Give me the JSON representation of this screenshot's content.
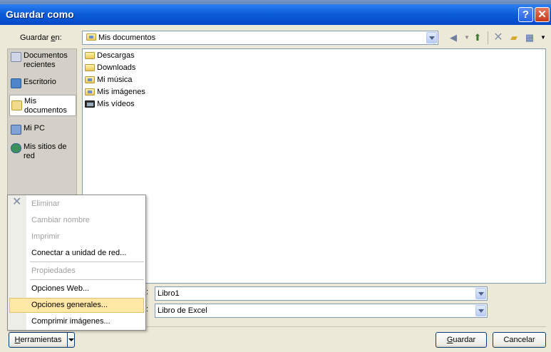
{
  "window": {
    "title": "Guardar como",
    "help_label": "?",
    "close_label": "✕"
  },
  "save_in": {
    "label_pre": "Guardar ",
    "label_key": "e",
    "label_post": "n:",
    "value": "Mis documentos"
  },
  "toolbar": {
    "back_icon": "back-arrow-icon",
    "up_icon": "up-folder-icon",
    "delete_icon": "delete-icon",
    "new_folder_icon": "new-folder-icon",
    "views_icon": "views-icon"
  },
  "places": [
    {
      "label": "Documentos recientes",
      "icon": "recent-documents-icon"
    },
    {
      "label": "Escritorio",
      "icon": "desktop-icon"
    },
    {
      "label": "Mis documentos",
      "icon": "my-documents-icon",
      "selected": true
    },
    {
      "label": "Mi PC",
      "icon": "my-computer-icon"
    },
    {
      "label": "Mis sitios de red",
      "icon": "network-places-icon"
    }
  ],
  "files": [
    {
      "name": "Descargas",
      "icon": "folder-icon"
    },
    {
      "name": "Downloads",
      "icon": "folder-icon"
    },
    {
      "name": "Mi música",
      "icon": "music-folder-icon"
    },
    {
      "name": "Mis imágenes",
      "icon": "pictures-folder-icon"
    },
    {
      "name": "Mis vídeos",
      "icon": "videos-folder-icon"
    }
  ],
  "file_name": {
    "label_suffix": ":",
    "value": "Libro1"
  },
  "file_type": {
    "label_suffix": ":",
    "value": "Libro de Excel"
  },
  "buttons": {
    "tools_key": "H",
    "tools_rest": "erramientas",
    "save_key": "G",
    "save_rest": "uardar",
    "cancel": "Cancelar"
  },
  "tools_menu": [
    {
      "label": "Eliminar",
      "disabled": true
    },
    {
      "label": "Cambiar nombre",
      "disabled": true
    },
    {
      "label": "Imprimir",
      "disabled": true
    },
    {
      "label": "Conectar a unidad de red...",
      "disabled": false
    },
    {
      "label": "Propiedades",
      "disabled": true
    },
    {
      "label": "Opciones Web...",
      "disabled": false
    },
    {
      "label": "Opciones generales...",
      "disabled": false,
      "highlighted": true
    },
    {
      "label": "Comprimir imágenes...",
      "disabled": false
    }
  ],
  "colors": {
    "title_bar": "#0A5FD8",
    "dialog_bg": "#ECE9D8",
    "menu_highlight": "#FFE8A6",
    "disabled_text": "#A1A1A1"
  }
}
